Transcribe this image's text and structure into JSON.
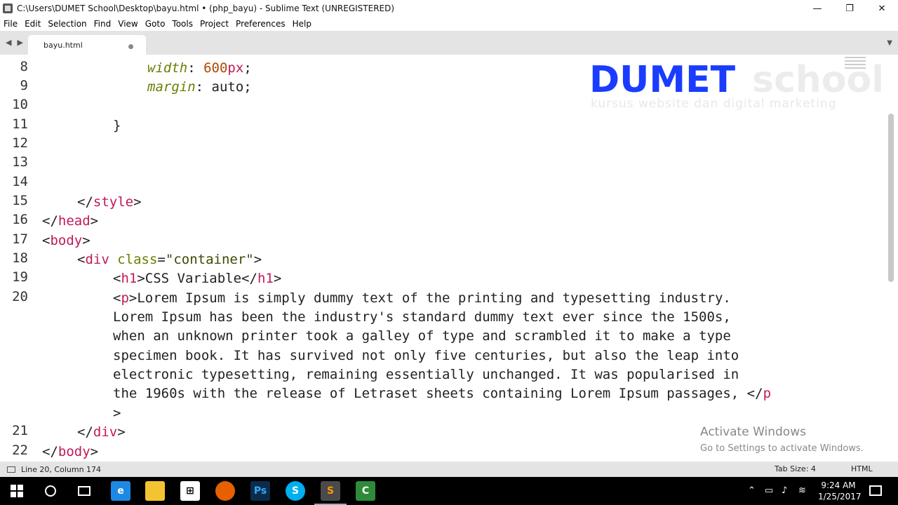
{
  "window": {
    "title": "C:\\Users\\DUMET School\\Desktop\\bayu.html • (php_bayu) - Sublime Text (UNREGISTERED)",
    "controls": [
      "—",
      "❐",
      "✕"
    ]
  },
  "menu": [
    "File",
    "Edit",
    "Selection",
    "Find",
    "View",
    "Goto",
    "Tools",
    "Project",
    "Preferences",
    "Help"
  ],
  "tabs": [
    {
      "label": "bayu.html",
      "dirty": true
    }
  ],
  "editor": {
    "lines": [
      {
        "n": "8"
      },
      {
        "n": "9"
      },
      {
        "n": "10"
      },
      {
        "n": "11"
      },
      {
        "n": "12"
      },
      {
        "n": "13"
      },
      {
        "n": "14"
      },
      {
        "n": "15"
      },
      {
        "n": "16"
      },
      {
        "n": "17"
      },
      {
        "n": "18"
      },
      {
        "n": "19"
      },
      {
        "n": "20"
      },
      {
        "n": "21"
      },
      {
        "n": "22"
      }
    ],
    "code": {
      "l8_prop": "width",
      "l8_colon": ": ",
      "l8_val": "600",
      "l8_unit": "px",
      "l8_semi": ";",
      "l9_prop": "margin",
      "l9_rest": ": auto;",
      "l11": "}",
      "l15_open": "</",
      "l15_tag": "style",
      "l15_close": ">",
      "l16_open": "</",
      "l16_tag": "head",
      "l16_close": ">",
      "l17_open": "<",
      "l17_tag": "body",
      "l17_close": ">",
      "l18_open": "<",
      "l18_tag": "div",
      "l18_attr": " class",
      "l18_eq": "=",
      "l18_str": "\"container\"",
      "l18_close": ">",
      "l19_open": "<",
      "l19_tag": "h1",
      "l19_text": ">CSS Variable</",
      "l19_tag2": "h1",
      "l19_close": ">",
      "l20_open": "<",
      "l20_tag": "p",
      "l20_a": ">Lorem Ipsum is simply dummy text of the printing and typesetting industry.",
      "l20_b": "Lorem Ipsum has been the industry's standard dummy text ever since the 1500s,",
      "l20_c": "when an unknown printer took a galley of type and scrambled it to make a type",
      "l20_d": "specimen book. It has survived not only five centuries, but also the leap into",
      "l20_e": "electronic typesetting, remaining essentially unchanged. It was popularised in",
      "l20_f": "the 1960s with the release of Letraset sheets containing Lorem Ipsum passages, </",
      "l20_f_tag": "p",
      "l20_g": ">",
      "l21_open": "</",
      "l21_tag": "div",
      "l21_close": ">",
      "l22_open": "</",
      "l22_tag": "body",
      "l22_close": ">"
    }
  },
  "watermark": {
    "brand": "DUMET",
    "brand_suffix": "school",
    "tagline": "kursus website dan digital marketing",
    "activate_title": "Activate Windows",
    "activate_sub": "Go to Settings to activate Windows."
  },
  "status": {
    "position": "Line 20, Column 174",
    "tab_size": "Tab Size: 4",
    "syntax": "HTML"
  },
  "taskbar": {
    "apps": [
      {
        "name": "edge-icon",
        "glyph": "e",
        "color": "#1e88e5"
      },
      {
        "name": "file-explorer-icon",
        "glyph": "",
        "color": "#f4c430"
      },
      {
        "name": "store-icon",
        "glyph": "",
        "color": "#ffffff"
      },
      {
        "name": "firefox-icon",
        "glyph": "",
        "color": "#e66000"
      },
      {
        "name": "photoshop-icon",
        "glyph": "Ps",
        "color": "#2b6ea8"
      },
      {
        "name": "skype-icon",
        "glyph": "S",
        "color": "#00aff0"
      },
      {
        "name": "sublime-text-icon",
        "glyph": "S",
        "color": "#4a4a4a"
      },
      {
        "name": "camtasia-icon",
        "glyph": "C",
        "color": "#2e8b3a"
      }
    ],
    "time": "9:24 AM",
    "date": "1/25/2017"
  },
  "colors": {
    "tag": "#c2185b",
    "attribute": "#6e7d00",
    "brand_blue": "#1a3cff"
  }
}
